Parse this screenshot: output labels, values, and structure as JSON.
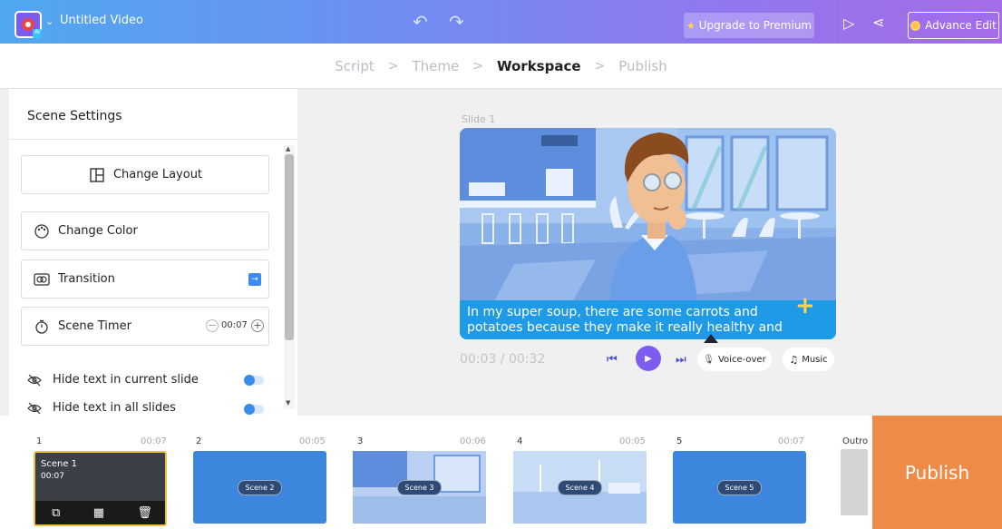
{
  "header": {
    "title": "Untitled Video",
    "upgrade_label": "Upgrade to Premium",
    "advance_label": "Advance Edit"
  },
  "stepper": {
    "steps": [
      "Script",
      "Theme",
      "Workspace",
      "Publish"
    ],
    "separator": ">"
  },
  "scene_settings": {
    "title": "Scene Settings",
    "change_layout": "Change Layout",
    "change_color": "Change Color",
    "transition": "Transition",
    "scene_timer": "Scene Timer",
    "timer_value": "00:07",
    "hide_current": "Hide text in current slide",
    "hide_all": "Hide text in all slides"
  },
  "workspace": {
    "slide_label": "Slide 1",
    "caption_line1": "In my super soup, there are some carrots and",
    "caption_line2": "potatoes because they make it really healthy and",
    "time": "00:03 / 00:32",
    "voiceover": "Voice-over",
    "music": "Music"
  },
  "timeline": {
    "scenes": [
      {
        "num": "1",
        "dur": "00:07",
        "label": "Scene 1",
        "time": "00:07"
      },
      {
        "num": "2",
        "dur": "00:05",
        "label": "Scene 2"
      },
      {
        "num": "3",
        "dur": "00:06",
        "label": "Scene 3"
      },
      {
        "num": "4",
        "dur": "00:05",
        "label": "Scene 4"
      },
      {
        "num": "5",
        "dur": "00:07",
        "label": "Scene 5"
      }
    ],
    "outro": "Outro"
  },
  "publish_label": "Publish",
  "colors": {
    "accent": "#7d5cf2",
    "publish": "#ee8b49",
    "caption": "#1e9ae6"
  }
}
